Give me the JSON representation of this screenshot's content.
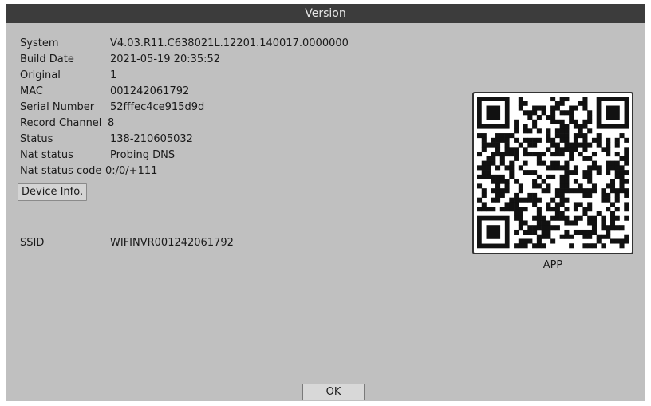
{
  "window": {
    "title": "Version"
  },
  "info": [
    {
      "label": "System",
      "value": "V4.03.R11.C638021L.12201.140017.0000000"
    },
    {
      "label": "Build Date",
      "value": "2021-05-19 20:35:52"
    },
    {
      "label": "Original",
      "value": "1"
    },
    {
      "label": "MAC",
      "value": "001242061792"
    },
    {
      "label": "Serial Number",
      "value": "52fffec4ce915d9d"
    },
    {
      "label": "Record Channel",
      "value": "8"
    },
    {
      "label": "Status",
      "value": "138-210605032"
    },
    {
      "label": "Nat status",
      "value": "Probing DNS"
    },
    {
      "label": "Nat status code",
      "value": "0:/0/+111"
    }
  ],
  "device_info_button": "Device Info.",
  "ssid": {
    "label": "SSID",
    "value": "WIFINVR001242061792"
  },
  "qr": {
    "caption": "APP"
  },
  "ok_button": "OK",
  "colors": {
    "panel": "#c0c0c0",
    "titlebar": "#3c3c3c",
    "text": "#1a1a1a"
  }
}
